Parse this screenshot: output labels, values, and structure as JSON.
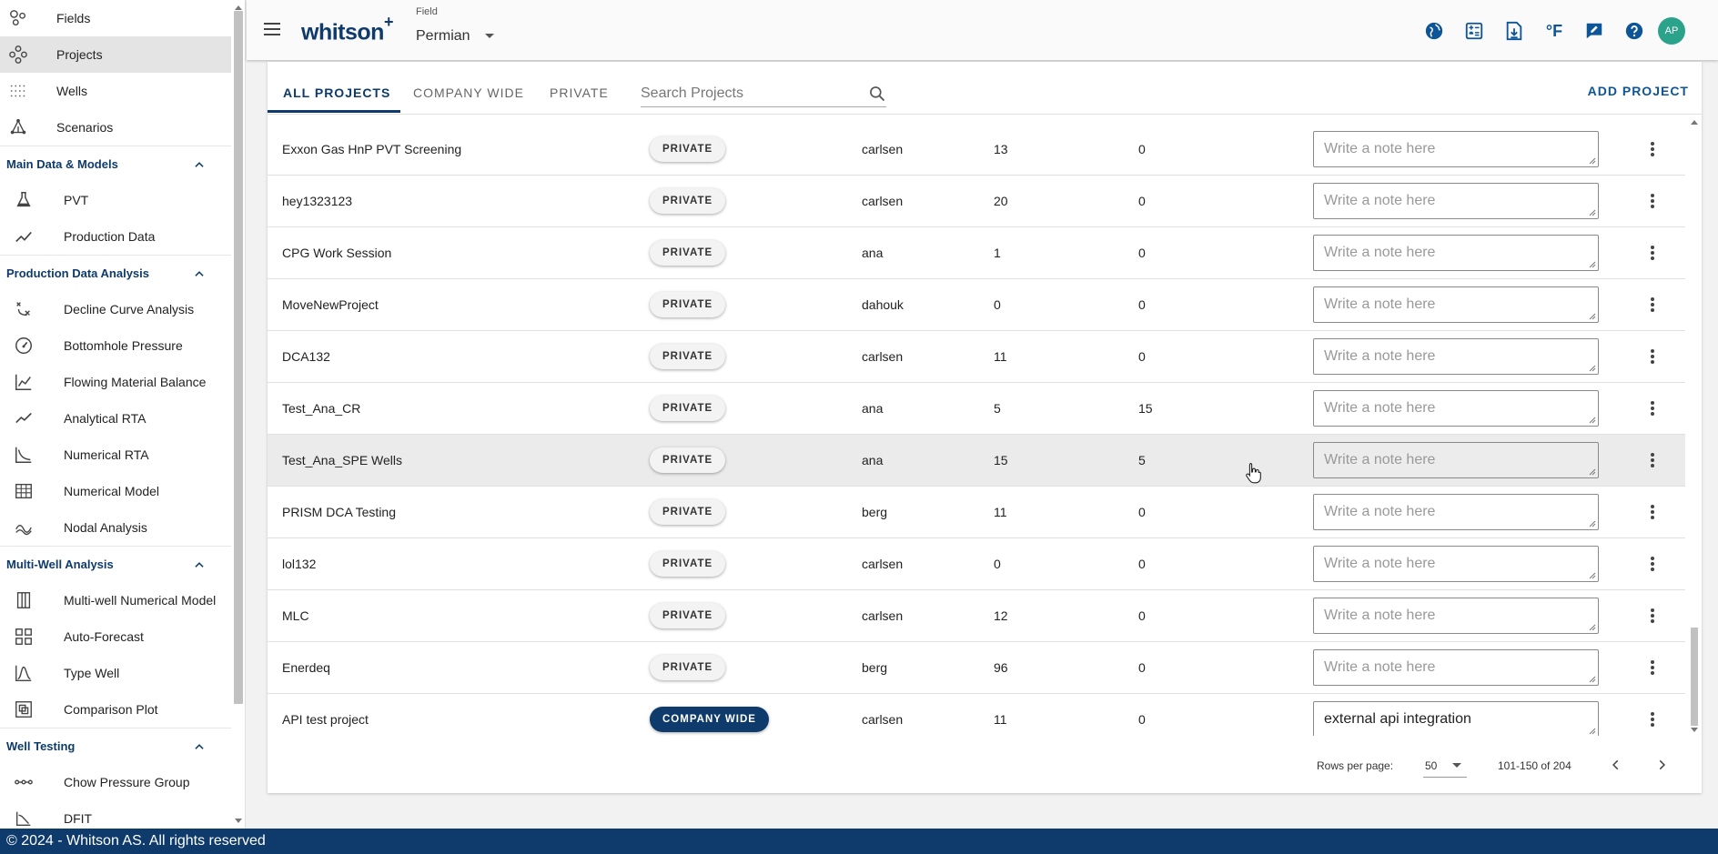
{
  "sidebar": {
    "top_items": [
      {
        "label": "Fields",
        "icon": "fields-icon"
      },
      {
        "label": "Projects",
        "icon": "projects-icon",
        "active": true
      },
      {
        "label": "Wells",
        "icon": "wells-icon"
      },
      {
        "label": "Scenarios",
        "icon": "scenarios-icon"
      }
    ],
    "sections": [
      {
        "title": "Main Data & Models",
        "items": [
          {
            "label": "PVT",
            "icon": "flask-icon"
          },
          {
            "label": "Production Data",
            "icon": "line-chart-icon"
          }
        ]
      },
      {
        "title": "Production Data Analysis",
        "items": [
          {
            "label": "Decline Curve Analysis",
            "icon": "decline-curve-icon"
          },
          {
            "label": "Bottomhole Pressure",
            "icon": "gauge-icon"
          },
          {
            "label": "Flowing Material Balance",
            "icon": "fmb-chart-icon"
          },
          {
            "label": "Analytical RTA",
            "icon": "trend-icon"
          },
          {
            "label": "Numerical RTA",
            "icon": "curve-chart-icon"
          },
          {
            "label": "Numerical Model",
            "icon": "grid-model-icon"
          },
          {
            "label": "Nodal Analysis",
            "icon": "nodal-icon"
          }
        ]
      },
      {
        "title": "Multi-Well Analysis",
        "items": [
          {
            "label": "Multi-well Numerical Model",
            "icon": "columns-icon"
          },
          {
            "label": "Auto-Forecast",
            "icon": "dashboard-icon"
          },
          {
            "label": "Type Well",
            "icon": "bell-curve-icon"
          },
          {
            "label": "Comparison Plot",
            "icon": "comparison-icon"
          }
        ]
      },
      {
        "title": "Well Testing",
        "items": [
          {
            "label": "Chow Pressure Group",
            "icon": "chain-icon"
          },
          {
            "label": "DFIT",
            "icon": "dfit-icon"
          }
        ]
      }
    ]
  },
  "header": {
    "brand": "whitson",
    "brand_plus": "+",
    "field_label": "Field",
    "field_value": "Permian",
    "icons": [
      "globe-icon",
      "calculator-icon",
      "download-file-icon",
      "temperature-unit-icon",
      "feedback-icon",
      "help-icon"
    ],
    "temperature_unit": "°F",
    "avatar_initials": "AP"
  },
  "projects": {
    "tabs": [
      {
        "label": "ALL PROJECTS",
        "active": true
      },
      {
        "label": "COMPANY WIDE",
        "active": false
      },
      {
        "label": "PRIVATE",
        "active": false
      }
    ],
    "search_placeholder": "Search Projects",
    "add_label": "ADD PROJECT",
    "note_placeholder": "Write a note here",
    "rows": [
      {
        "name": "Exxon Gas HnP PVT Screening",
        "visibility": "PRIVATE",
        "owner": "carlsen",
        "count1": "13",
        "count2": "0",
        "note": ""
      },
      {
        "name": "hey1323123",
        "visibility": "PRIVATE",
        "owner": "carlsen",
        "count1": "20",
        "count2": "0",
        "note": ""
      },
      {
        "name": "CPG Work Session",
        "visibility": "PRIVATE",
        "owner": "ana",
        "count1": "1",
        "count2": "0",
        "note": ""
      },
      {
        "name": "MoveNewProject",
        "visibility": "PRIVATE",
        "owner": "dahouk",
        "count1": "0",
        "count2": "0",
        "note": ""
      },
      {
        "name": "DCA132",
        "visibility": "PRIVATE",
        "owner": "carlsen",
        "count1": "11",
        "count2": "0",
        "note": ""
      },
      {
        "name": "Test_Ana_CR",
        "visibility": "PRIVATE",
        "owner": "ana",
        "count1": "5",
        "count2": "15",
        "note": ""
      },
      {
        "name": "Test_Ana_SPE Wells",
        "visibility": "PRIVATE",
        "owner": "ana",
        "count1": "15",
        "count2": "5",
        "note": "",
        "hover": true
      },
      {
        "name": "PRISM DCA Testing",
        "visibility": "PRIVATE",
        "owner": "berg",
        "count1": "11",
        "count2": "0",
        "note": ""
      },
      {
        "name": "lol132",
        "visibility": "PRIVATE",
        "owner": "carlsen",
        "count1": "0",
        "count2": "0",
        "note": ""
      },
      {
        "name": "MLC",
        "visibility": "PRIVATE",
        "owner": "carlsen",
        "count1": "12",
        "count2": "0",
        "note": ""
      },
      {
        "name": "Enerdeq",
        "visibility": "PRIVATE",
        "owner": "berg",
        "count1": "96",
        "count2": "0",
        "note": ""
      },
      {
        "name": "API test project",
        "visibility": "COMPANY WIDE",
        "owner": "carlsen",
        "count1": "11",
        "count2": "0",
        "note": "external api integration"
      }
    ],
    "pagination": {
      "rows_per_page_label": "Rows per page:",
      "rows_per_page": "50",
      "range": "101-150 of 204"
    }
  },
  "footer": {
    "text": "© 2024 - Whitson AS. All rights reserved"
  },
  "colors": {
    "primary": "#0e3b6b",
    "accent_link": "#0e5597",
    "avatar": "#2aa38a"
  }
}
